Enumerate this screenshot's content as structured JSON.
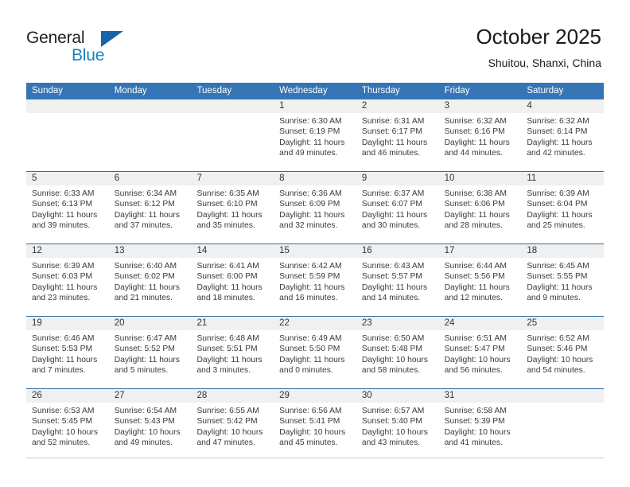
{
  "brand": {
    "logo_text_top": "General",
    "logo_text_bottom": "Blue",
    "accent_color": "#1a7fc1",
    "triangle_color": "#1565a8"
  },
  "header": {
    "title": "October 2025",
    "subtitle": "Shuitou, Shanxi, China"
  },
  "calendar": {
    "header_bg": "#3574b5",
    "row_divider_color": "#2e6da4",
    "daynum_band_bg": "#f0f0f0",
    "weekdays": [
      "Sunday",
      "Monday",
      "Tuesday",
      "Wednesday",
      "Thursday",
      "Friday",
      "Saturday"
    ],
    "weeks": [
      [
        {
          "day": "",
          "empty": true,
          "sunrise": "",
          "sunset": "",
          "daylight_line1": "",
          "daylight_line2": ""
        },
        {
          "day": "",
          "empty": true,
          "sunrise": "",
          "sunset": "",
          "daylight_line1": "",
          "daylight_line2": ""
        },
        {
          "day": "",
          "empty": true,
          "sunrise": "",
          "sunset": "",
          "daylight_line1": "",
          "daylight_line2": ""
        },
        {
          "day": "1",
          "empty": false,
          "sunrise": "Sunrise: 6:30 AM",
          "sunset": "Sunset: 6:19 PM",
          "daylight_line1": "Daylight: 11 hours",
          "daylight_line2": "and 49 minutes."
        },
        {
          "day": "2",
          "empty": false,
          "sunrise": "Sunrise: 6:31 AM",
          "sunset": "Sunset: 6:17 PM",
          "daylight_line1": "Daylight: 11 hours",
          "daylight_line2": "and 46 minutes."
        },
        {
          "day": "3",
          "empty": false,
          "sunrise": "Sunrise: 6:32 AM",
          "sunset": "Sunset: 6:16 PM",
          "daylight_line1": "Daylight: 11 hours",
          "daylight_line2": "and 44 minutes."
        },
        {
          "day": "4",
          "empty": false,
          "sunrise": "Sunrise: 6:32 AM",
          "sunset": "Sunset: 6:14 PM",
          "daylight_line1": "Daylight: 11 hours",
          "daylight_line2": "and 42 minutes."
        }
      ],
      [
        {
          "day": "5",
          "empty": false,
          "sunrise": "Sunrise: 6:33 AM",
          "sunset": "Sunset: 6:13 PM",
          "daylight_line1": "Daylight: 11 hours",
          "daylight_line2": "and 39 minutes."
        },
        {
          "day": "6",
          "empty": false,
          "sunrise": "Sunrise: 6:34 AM",
          "sunset": "Sunset: 6:12 PM",
          "daylight_line1": "Daylight: 11 hours",
          "daylight_line2": "and 37 minutes."
        },
        {
          "day": "7",
          "empty": false,
          "sunrise": "Sunrise: 6:35 AM",
          "sunset": "Sunset: 6:10 PM",
          "daylight_line1": "Daylight: 11 hours",
          "daylight_line2": "and 35 minutes."
        },
        {
          "day": "8",
          "empty": false,
          "sunrise": "Sunrise: 6:36 AM",
          "sunset": "Sunset: 6:09 PM",
          "daylight_line1": "Daylight: 11 hours",
          "daylight_line2": "and 32 minutes."
        },
        {
          "day": "9",
          "empty": false,
          "sunrise": "Sunrise: 6:37 AM",
          "sunset": "Sunset: 6:07 PM",
          "daylight_line1": "Daylight: 11 hours",
          "daylight_line2": "and 30 minutes."
        },
        {
          "day": "10",
          "empty": false,
          "sunrise": "Sunrise: 6:38 AM",
          "sunset": "Sunset: 6:06 PM",
          "daylight_line1": "Daylight: 11 hours",
          "daylight_line2": "and 28 minutes."
        },
        {
          "day": "11",
          "empty": false,
          "sunrise": "Sunrise: 6:39 AM",
          "sunset": "Sunset: 6:04 PM",
          "daylight_line1": "Daylight: 11 hours",
          "daylight_line2": "and 25 minutes."
        }
      ],
      [
        {
          "day": "12",
          "empty": false,
          "sunrise": "Sunrise: 6:39 AM",
          "sunset": "Sunset: 6:03 PM",
          "daylight_line1": "Daylight: 11 hours",
          "daylight_line2": "and 23 minutes."
        },
        {
          "day": "13",
          "empty": false,
          "sunrise": "Sunrise: 6:40 AM",
          "sunset": "Sunset: 6:02 PM",
          "daylight_line1": "Daylight: 11 hours",
          "daylight_line2": "and 21 minutes."
        },
        {
          "day": "14",
          "empty": false,
          "sunrise": "Sunrise: 6:41 AM",
          "sunset": "Sunset: 6:00 PM",
          "daylight_line1": "Daylight: 11 hours",
          "daylight_line2": "and 18 minutes."
        },
        {
          "day": "15",
          "empty": false,
          "sunrise": "Sunrise: 6:42 AM",
          "sunset": "Sunset: 5:59 PM",
          "daylight_line1": "Daylight: 11 hours",
          "daylight_line2": "and 16 minutes."
        },
        {
          "day": "16",
          "empty": false,
          "sunrise": "Sunrise: 6:43 AM",
          "sunset": "Sunset: 5:57 PM",
          "daylight_line1": "Daylight: 11 hours",
          "daylight_line2": "and 14 minutes."
        },
        {
          "day": "17",
          "empty": false,
          "sunrise": "Sunrise: 6:44 AM",
          "sunset": "Sunset: 5:56 PM",
          "daylight_line1": "Daylight: 11 hours",
          "daylight_line2": "and 12 minutes."
        },
        {
          "day": "18",
          "empty": false,
          "sunrise": "Sunrise: 6:45 AM",
          "sunset": "Sunset: 5:55 PM",
          "daylight_line1": "Daylight: 11 hours",
          "daylight_line2": "and 9 minutes."
        }
      ],
      [
        {
          "day": "19",
          "empty": false,
          "sunrise": "Sunrise: 6:46 AM",
          "sunset": "Sunset: 5:53 PM",
          "daylight_line1": "Daylight: 11 hours",
          "daylight_line2": "and 7 minutes."
        },
        {
          "day": "20",
          "empty": false,
          "sunrise": "Sunrise: 6:47 AM",
          "sunset": "Sunset: 5:52 PM",
          "daylight_line1": "Daylight: 11 hours",
          "daylight_line2": "and 5 minutes."
        },
        {
          "day": "21",
          "empty": false,
          "sunrise": "Sunrise: 6:48 AM",
          "sunset": "Sunset: 5:51 PM",
          "daylight_line1": "Daylight: 11 hours",
          "daylight_line2": "and 3 minutes."
        },
        {
          "day": "22",
          "empty": false,
          "sunrise": "Sunrise: 6:49 AM",
          "sunset": "Sunset: 5:50 PM",
          "daylight_line1": "Daylight: 11 hours",
          "daylight_line2": "and 0 minutes."
        },
        {
          "day": "23",
          "empty": false,
          "sunrise": "Sunrise: 6:50 AM",
          "sunset": "Sunset: 5:48 PM",
          "daylight_line1": "Daylight: 10 hours",
          "daylight_line2": "and 58 minutes."
        },
        {
          "day": "24",
          "empty": false,
          "sunrise": "Sunrise: 6:51 AM",
          "sunset": "Sunset: 5:47 PM",
          "daylight_line1": "Daylight: 10 hours",
          "daylight_line2": "and 56 minutes."
        },
        {
          "day": "25",
          "empty": false,
          "sunrise": "Sunrise: 6:52 AM",
          "sunset": "Sunset: 5:46 PM",
          "daylight_line1": "Daylight: 10 hours",
          "daylight_line2": "and 54 minutes."
        }
      ],
      [
        {
          "day": "26",
          "empty": false,
          "sunrise": "Sunrise: 6:53 AM",
          "sunset": "Sunset: 5:45 PM",
          "daylight_line1": "Daylight: 10 hours",
          "daylight_line2": "and 52 minutes."
        },
        {
          "day": "27",
          "empty": false,
          "sunrise": "Sunrise: 6:54 AM",
          "sunset": "Sunset: 5:43 PM",
          "daylight_line1": "Daylight: 10 hours",
          "daylight_line2": "and 49 minutes."
        },
        {
          "day": "28",
          "empty": false,
          "sunrise": "Sunrise: 6:55 AM",
          "sunset": "Sunset: 5:42 PM",
          "daylight_line1": "Daylight: 10 hours",
          "daylight_line2": "and 47 minutes."
        },
        {
          "day": "29",
          "empty": false,
          "sunrise": "Sunrise: 6:56 AM",
          "sunset": "Sunset: 5:41 PM",
          "daylight_line1": "Daylight: 10 hours",
          "daylight_line2": "and 45 minutes."
        },
        {
          "day": "30",
          "empty": false,
          "sunrise": "Sunrise: 6:57 AM",
          "sunset": "Sunset: 5:40 PM",
          "daylight_line1": "Daylight: 10 hours",
          "daylight_line2": "and 43 minutes."
        },
        {
          "day": "31",
          "empty": false,
          "sunrise": "Sunrise: 6:58 AM",
          "sunset": "Sunset: 5:39 PM",
          "daylight_line1": "Daylight: 10 hours",
          "daylight_line2": "and 41 minutes."
        },
        {
          "day": "",
          "empty": true,
          "sunrise": "",
          "sunset": "",
          "daylight_line1": "",
          "daylight_line2": ""
        }
      ]
    ]
  }
}
